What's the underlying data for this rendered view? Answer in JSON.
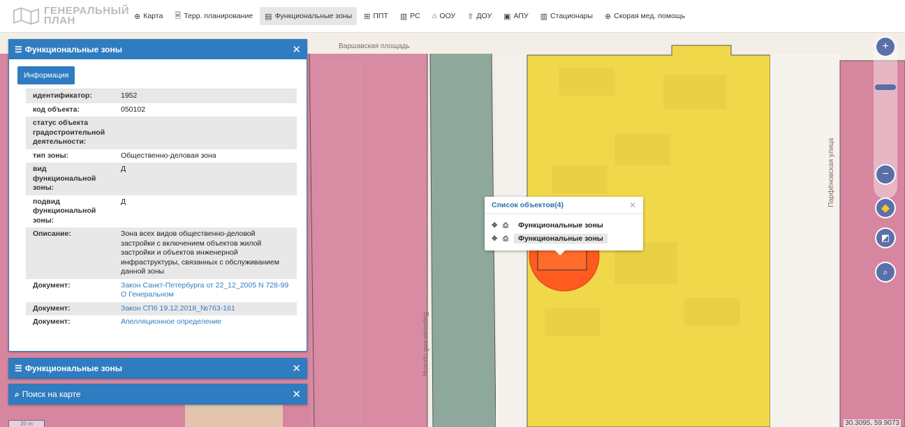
{
  "logo": {
    "line1": "ГЕНЕРАЛЬНЫЙ",
    "line2": "ПЛАН"
  },
  "nav": [
    {
      "icon": "⊕",
      "label": "Карта"
    },
    {
      "icon": "🗎",
      "label": "Терр. планирование"
    },
    {
      "icon": "▤",
      "label": "Функциональные зоны"
    },
    {
      "icon": "⊞",
      "label": "ППТ"
    },
    {
      "icon": "▥",
      "label": "РС"
    },
    {
      "icon": "⌂",
      "label": "ООУ"
    },
    {
      "icon": "⇧",
      "label": "ДОУ"
    },
    {
      "icon": "▣",
      "label": "АПУ"
    },
    {
      "icon": "▥",
      "label": "Стационары"
    },
    {
      "icon": "⊕",
      "label": "Скорая мед. помощь"
    }
  ],
  "panel1": {
    "title": "Функциональные зоны",
    "info_button": "Информация",
    "rows": [
      {
        "key": "идентификатор:",
        "value": "1952"
      },
      {
        "key": "код объекта:",
        "value": "050102"
      },
      {
        "key": "статус объекта градостроительной деятельности:",
        "value": ""
      },
      {
        "key": "тип зоны:",
        "value": "Общественно-деловая зона"
      },
      {
        "key": "вид функциональной зоны:",
        "value": "Д"
      },
      {
        "key": "подвид функциональной зоны:",
        "value": "Д"
      },
      {
        "key": "Описание:",
        "value": "Зона всех видов общественно-деловой застройки с включением объектов жилой застройки и объектов инженерной инфраструктуры, связанных с обслуживанием данной зоны"
      }
    ],
    "docs": [
      {
        "key": "Документ:",
        "value": "Закон Санкт-Петербурга от 22_12_2005 N 728-99 О Генеральном"
      },
      {
        "key": "Документ:",
        "value": "Закон СПб 19.12.2018_№763-161"
      },
      {
        "key": "Документ:",
        "value": "Апелляционное определение"
      }
    ]
  },
  "panel2": {
    "title": "Функциональные зоны"
  },
  "panel3": {
    "title": "Поиск на карте"
  },
  "popup": {
    "title": "Список объектов(4)",
    "items": [
      "Функциональные зоны",
      "Функциональные зоны"
    ]
  },
  "map": {
    "street1": "Варшавская площадь",
    "street2": "Варшавский проезд",
    "street3": "Парфёновская улица",
    "coords": "30.3095, 59.9073",
    "scale": "20 m"
  },
  "colors": {
    "accent": "#2f7cc1",
    "zone_pink": "#d7869f",
    "zone_yellow": "#f1d84a",
    "zone_green": "#8fa89c",
    "marker": "#ff5a1f"
  }
}
